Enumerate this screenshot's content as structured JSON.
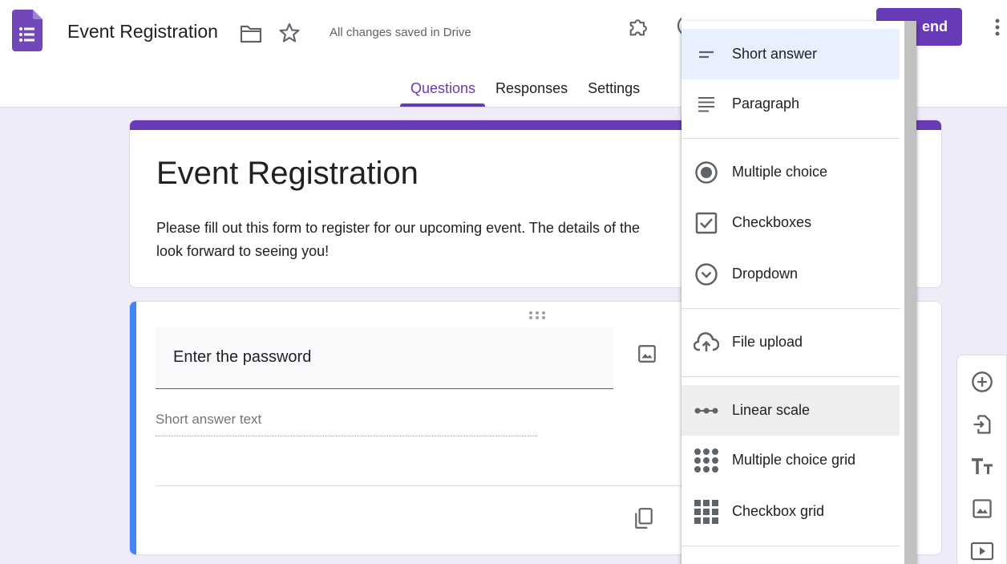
{
  "header": {
    "doc_title": "Event Registration",
    "save_status": "All changes saved in Drive",
    "send_label": "end",
    "tabs": [
      {
        "label": "Questions",
        "active": true
      },
      {
        "label": "Responses",
        "active": false
      },
      {
        "label": "Settings",
        "active": false
      }
    ],
    "icons": [
      "forms-logo-icon",
      "folder-icon",
      "star-icon",
      "addon-puzzle-icon",
      "palette-icon",
      "more-vert-icon"
    ]
  },
  "form": {
    "title": "Event Registration",
    "description": "Please fill out this form to register for our upcoming event. The details of the look forward to seeing you!",
    "description_line1": "Please fill out this form to register for our upcoming event. The details of the",
    "description_line2": "look forward to seeing you!"
  },
  "question": {
    "title": "Enter the password",
    "answer_placeholder": "Short answer text"
  },
  "question_type_menu": {
    "items": [
      {
        "label": "Short answer",
        "icon": "short-answer-icon",
        "state": "selected"
      },
      {
        "label": "Paragraph",
        "icon": "paragraph-icon"
      },
      {
        "label": "Multiple choice",
        "icon": "radio-icon"
      },
      {
        "label": "Checkboxes",
        "icon": "checkbox-icon"
      },
      {
        "label": "Dropdown",
        "icon": "dropdown-circle-icon"
      },
      {
        "label": "File upload",
        "icon": "cloud-upload-icon"
      },
      {
        "label": "Linear scale",
        "icon": "linear-scale-icon",
        "state": "hover"
      },
      {
        "label": "Multiple choice grid",
        "icon": "dots-grid-icon"
      },
      {
        "label": "Checkbox grid",
        "icon": "squares-grid-icon"
      }
    ]
  },
  "side_toolbar": {
    "tools": [
      "add-question-icon",
      "import-questions-icon",
      "add-title-icon",
      "add-image-icon",
      "add-video-icon"
    ]
  },
  "colors": {
    "brand_purple": "#673ab7",
    "page_bg": "#f0ebf8",
    "active_question_bar": "#4285f4",
    "menu_selected": "#e8f0fe"
  }
}
